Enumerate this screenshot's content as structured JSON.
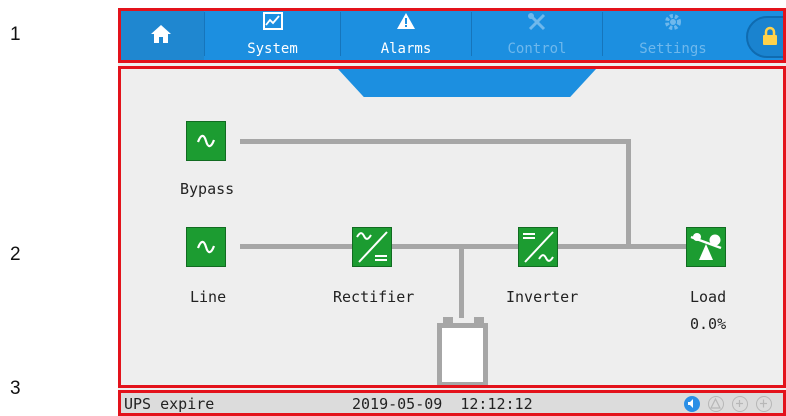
{
  "annotations": [
    "1",
    "2",
    "3"
  ],
  "topbar": {
    "home_icon": "home-icon",
    "tabs": [
      {
        "label": "System",
        "icon": "chart-icon"
      },
      {
        "label": "Alarms",
        "icon": "warning-icon"
      },
      {
        "label": "Control",
        "icon": "tools-icon"
      },
      {
        "label": "Settings",
        "icon": "gear-icon"
      }
    ],
    "lock_icon": "lock-icon"
  },
  "diagram": {
    "bypass": {
      "label": "Bypass",
      "icon": "sine-icon"
    },
    "line": {
      "label": "Line",
      "icon": "sine-icon"
    },
    "rectifier": {
      "label": "Rectifier",
      "icon": "ac-dc-icon"
    },
    "inverter": {
      "label": "Inverter",
      "icon": "dc-ac-icon"
    },
    "load": {
      "label": "Load",
      "value": "0.0%",
      "icon": "load-icon"
    },
    "battery": {
      "icon": "battery-icon"
    }
  },
  "statusbar": {
    "message": "UPS expire",
    "datetime": "2019-05-09  12:12:12",
    "icons": [
      "sound-icon",
      "alarm-icon",
      "bypass-indicator-icon",
      "output-indicator-icon"
    ]
  },
  "colors": {
    "accent": "#1c8fe0",
    "block_green": "#1c9c31",
    "frame_red": "#e3121b",
    "wire_gray": "#a6a6a6"
  }
}
